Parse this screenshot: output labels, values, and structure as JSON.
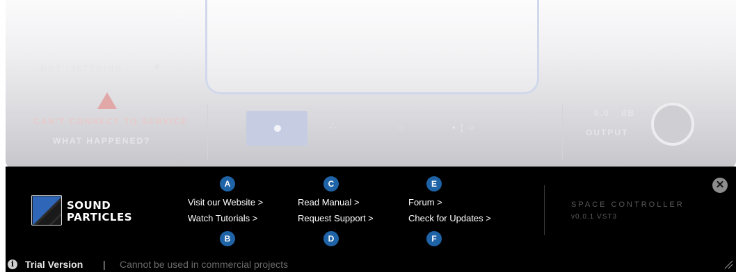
{
  "background_plugin": {
    "listening_label": "NOT LISTENING",
    "error_title": "CAN'T CONNECT TO SERVICE",
    "error_link": "WHAT HAPPENED?",
    "output_value": "0.0",
    "output_unit": "dB",
    "output_label": "OUTPUT"
  },
  "about": {
    "logo": {
      "line1": "SOUND",
      "line2": "PARTICLES"
    },
    "links": [
      {
        "badge": "A",
        "label": "Visit our Website >"
      },
      {
        "badge": "B",
        "label": "Watch Tutorials >"
      },
      {
        "badge": "C",
        "label": "Read Manual >"
      },
      {
        "badge": "D",
        "label": "Request Support >"
      },
      {
        "badge": "E",
        "label": "Forum >"
      },
      {
        "badge": "F",
        "label": "Check for Updates >"
      }
    ],
    "product": {
      "name": "SPACE CONTROLLER",
      "version": "v0.0.1 VST3"
    },
    "close_icon": "close-icon"
  },
  "footer": {
    "info_icon": "info-icon",
    "trial_label": "Trial Version",
    "separator": "|",
    "trial_note": "Cannot be used in commercial projects"
  },
  "colors": {
    "panel_bg": "#000000",
    "badge_blue": "#1f63a7",
    "accent_blue": "#2f66b8"
  }
}
